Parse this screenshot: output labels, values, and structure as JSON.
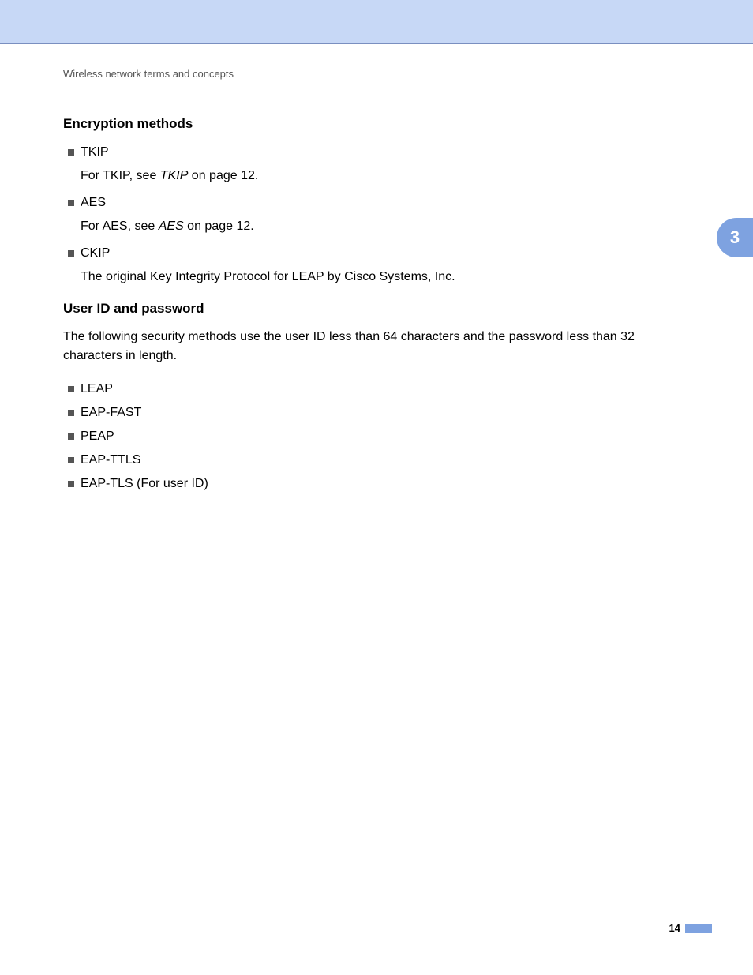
{
  "header": {
    "running_title": "Wireless network terms and concepts"
  },
  "chapter_tab": "3",
  "sections": {
    "encryption": {
      "heading": "Encryption methods",
      "items": {
        "tkip": {
          "name": "TKIP",
          "sub1": "For TKIP, see ",
          "link": "TKIP",
          "sub2": " on page 12."
        },
        "aes": {
          "name": "AES",
          "sub1": "For AES, see ",
          "link": "AES",
          "sub2": " on page 12."
        },
        "ckip": {
          "name": "CKIP",
          "sub": "The original Key Integrity Protocol for LEAP by Cisco Systems, Inc."
        }
      }
    },
    "userid": {
      "heading": "User ID and password",
      "intro": "The following security methods use the user ID less than 64 characters and the password less than 32 characters in length.",
      "items": {
        "leap": "LEAP",
        "eapfast": "EAP-FAST",
        "peap": "PEAP",
        "eapttls": "EAP-TTLS",
        "eaptls": "EAP-TLS (For user ID)"
      }
    }
  },
  "footer": {
    "page_number": "14"
  }
}
